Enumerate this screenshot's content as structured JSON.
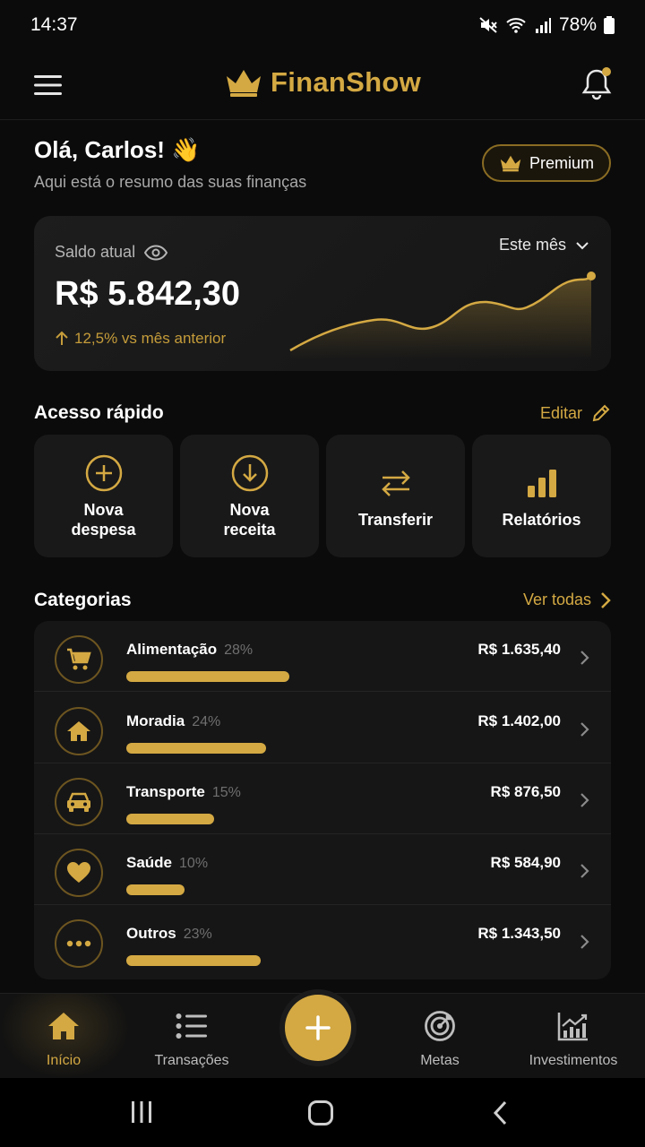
{
  "status_bar": {
    "time": "14:37",
    "battery": "78%"
  },
  "header": {
    "app_name": "FinanShow"
  },
  "greeting": {
    "title": "Olá, Carlos! 👋",
    "subtitle": "Aqui está o resumo das suas finanças",
    "premium_label": "Premium"
  },
  "balance": {
    "label": "Saldo atual",
    "value": "R$ 5.842,30",
    "change": "12,5% vs mês anterior",
    "period": "Este mês"
  },
  "quick_access": {
    "title": "Acesso rápido",
    "edit_label": "Editar",
    "items": [
      {
        "label": "Nova\ndespesa",
        "icon": "plus-circle-icon"
      },
      {
        "label": "Nova\nreceita",
        "icon": "download-circle-icon"
      },
      {
        "label": "Transferir",
        "icon": "transfer-icon"
      },
      {
        "label": "Relatórios",
        "icon": "bar-chart-icon"
      }
    ]
  },
  "categories": {
    "title": "Categorias",
    "see_all_label": "Ver todas",
    "items": [
      {
        "name": "Alimentação",
        "pct": "28%",
        "amount": "R$ 1.635,40",
        "share": 0.28,
        "icon": "cart-icon"
      },
      {
        "name": "Moradia",
        "pct": "24%",
        "amount": "R$ 1.402,00",
        "share": 0.24,
        "icon": "home-icon"
      },
      {
        "name": "Transporte",
        "pct": "15%",
        "amount": "R$ 876,50",
        "share": 0.15,
        "icon": "car-icon"
      },
      {
        "name": "Saúde",
        "pct": "10%",
        "amount": "R$ 584,90",
        "share": 0.1,
        "icon": "heart-icon"
      },
      {
        "name": "Outros",
        "pct": "23%",
        "amount": "R$ 1.343,50",
        "share": 0.23,
        "icon": "more-icon"
      }
    ]
  },
  "bottom_nav": {
    "items": [
      {
        "label": "Início",
        "icon": "home-icon",
        "active": true
      },
      {
        "label": "Transações",
        "icon": "list-icon"
      },
      {
        "label": "Metas",
        "icon": "target-icon"
      },
      {
        "label": "Investimentos",
        "icon": "growth-chart-icon"
      }
    ]
  },
  "colors": {
    "accent": "#d4a943",
    "background": "#0b0b0b",
    "card": "#191919"
  }
}
